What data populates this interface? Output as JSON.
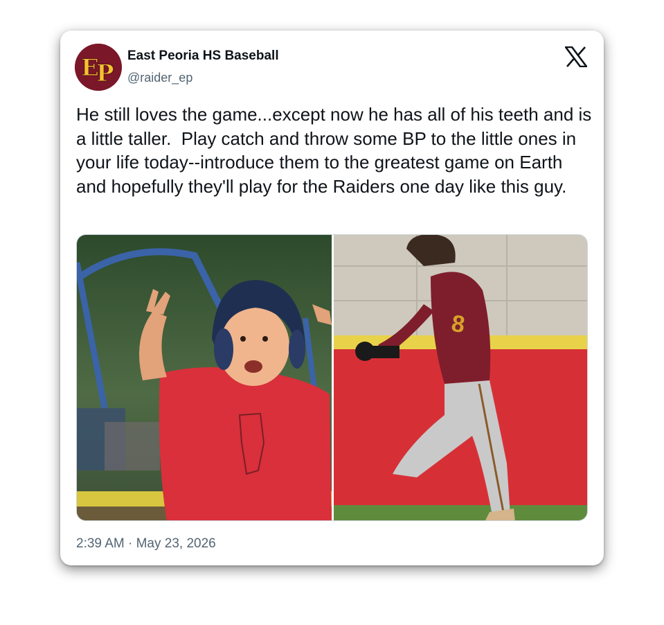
{
  "author": {
    "display_name": "East Peoria HS Baseball",
    "handle": "@raider_ep",
    "avatar_monogram": "EP",
    "avatar_bg_color": "#7a1728",
    "avatar_text_color": "#f2c230"
  },
  "tweet": {
    "text": "He still loves the game...except now he has all of his teeth and is a little taller.  Play catch and throw some BP to the little ones in your life today--introduce them to the greatest game on Earth and hopefully they'll play for the Raiders one day like this guy.",
    "timestamp": "2:39 AM · May 23, 2026"
  },
  "icons": {
    "platform_logo": "x-logo-icon"
  },
  "media": {
    "images": [
      {
        "name": "child-batting-helmet-photo",
        "description_icon": "photo-icon"
      },
      {
        "name": "high-school-player-running-photo",
        "description_icon": "photo-icon"
      }
    ]
  },
  "colors": {
    "text_primary": "#0f1419",
    "text_secondary": "#536471",
    "card_bg": "#ffffff"
  }
}
